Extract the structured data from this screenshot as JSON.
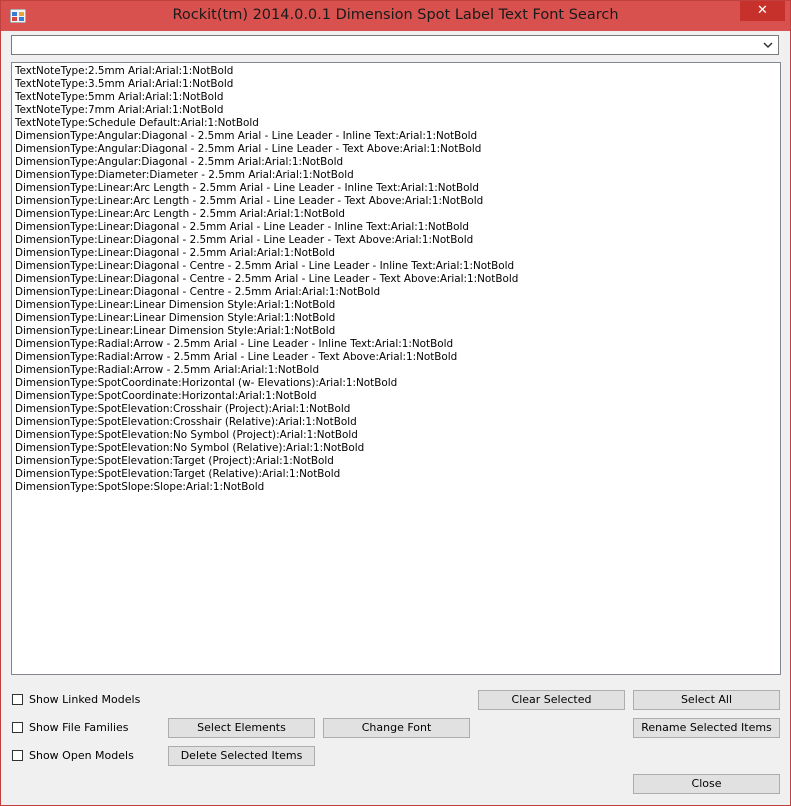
{
  "window": {
    "title": "Rockit(tm) 2014.0.0.1 Dimension Spot Label Text Font Search",
    "close_glyph": "✕"
  },
  "search": {
    "value": "",
    "dropdown_icon": "chevron-down-icon"
  },
  "list": {
    "items": [
      "TextNoteType:2.5mm Arial:Arial:1:NotBold",
      "TextNoteType:3.5mm Arial:Arial:1:NotBold",
      "TextNoteType:5mm Arial:Arial:1:NotBold",
      "TextNoteType:7mm Arial:Arial:1:NotBold",
      "TextNoteType:Schedule Default:Arial:1:NotBold",
      "DimensionType:Angular:Diagonal - 2.5mm Arial - Line Leader - Inline Text:Arial:1:NotBold",
      "DimensionType:Angular:Diagonal - 2.5mm Arial - Line Leader - Text Above:Arial:1:NotBold",
      "DimensionType:Angular:Diagonal - 2.5mm Arial:Arial:1:NotBold",
      "DimensionType:Diameter:Diameter - 2.5mm Arial:Arial:1:NotBold",
      "DimensionType:Linear:Arc Length - 2.5mm Arial - Line Leader - Inline Text:Arial:1:NotBold",
      "DimensionType:Linear:Arc Length - 2.5mm Arial - Line Leader - Text Above:Arial:1:NotBold",
      "DimensionType:Linear:Arc Length - 2.5mm Arial:Arial:1:NotBold",
      "DimensionType:Linear:Diagonal - 2.5mm Arial - Line Leader - Inline Text:Arial:1:NotBold",
      "DimensionType:Linear:Diagonal - 2.5mm Arial - Line Leader - Text Above:Arial:1:NotBold",
      "DimensionType:Linear:Diagonal - 2.5mm Arial:Arial:1:NotBold",
      "DimensionType:Linear:Diagonal - Centre - 2.5mm Arial - Line Leader - Inline Text:Arial:1:NotBold",
      "DimensionType:Linear:Diagonal - Centre - 2.5mm Arial - Line Leader - Text Above:Arial:1:NotBold",
      "DimensionType:Linear:Diagonal - Centre - 2.5mm Arial:Arial:1:NotBold",
      "DimensionType:Linear:Linear Dimension Style:Arial:1:NotBold",
      "DimensionType:Linear:Linear Dimension Style:Arial:1:NotBold",
      "DimensionType:Linear:Linear Dimension Style:Arial:1:NotBold",
      "DimensionType:Radial:Arrow - 2.5mm Arial - Line Leader - Inline Text:Arial:1:NotBold",
      "DimensionType:Radial:Arrow - 2.5mm Arial - Line Leader - Text Above:Arial:1:NotBold",
      "DimensionType:Radial:Arrow - 2.5mm Arial:Arial:1:NotBold",
      "DimensionType:SpotCoordinate:Horizontal  (w- Elevations):Arial:1:NotBold",
      "DimensionType:SpotCoordinate:Horizontal:Arial:1:NotBold",
      "DimensionType:SpotElevation:Crosshair (Project):Arial:1:NotBold",
      "DimensionType:SpotElevation:Crosshair (Relative):Arial:1:NotBold",
      "DimensionType:SpotElevation:No Symbol (Project):Arial:1:NotBold",
      "DimensionType:SpotElevation:No Symbol (Relative):Arial:1:NotBold",
      "DimensionType:SpotElevation:Target (Project):Arial:1:NotBold",
      "DimensionType:SpotElevation:Target (Relative):Arial:1:NotBold",
      "DimensionType:SpotSlope:Slope:Arial:1:NotBold"
    ]
  },
  "options": {
    "show_linked_models": {
      "label": "Show Linked Models",
      "checked": false
    },
    "show_file_families": {
      "label": "Show File Families",
      "checked": false
    },
    "show_open_models": {
      "label": "Show Open Models",
      "checked": false
    }
  },
  "buttons": {
    "clear_selected": "Clear Selected",
    "select_all": "Select All",
    "select_elements": "Select Elements",
    "change_font": "Change Font",
    "rename_selected": "Rename Selected Items",
    "delete_selected": "Delete Selected Items",
    "close": "Close"
  },
  "colors": {
    "titlebar": "#d9514e",
    "close_button": "#c7312b",
    "window_bg": "#f0f0f0"
  }
}
